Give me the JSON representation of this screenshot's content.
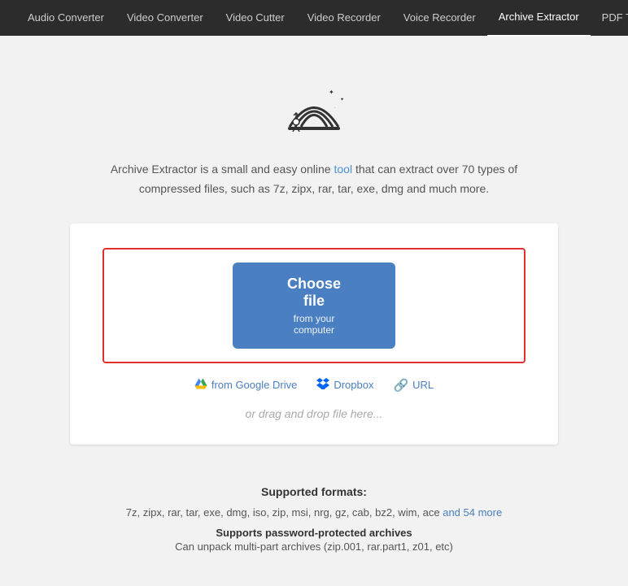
{
  "nav": {
    "items": [
      {
        "label": "Audio Converter",
        "active": false
      },
      {
        "label": "Video Converter",
        "active": false
      },
      {
        "label": "Video Cutter",
        "active": false
      },
      {
        "label": "Video Recorder",
        "active": false
      },
      {
        "label": "Voice Recorder",
        "active": false
      },
      {
        "label": "Archive Extractor",
        "active": true
      },
      {
        "label": "PDF Tools",
        "active": false
      }
    ]
  },
  "hero": {
    "description_1": "Archive Extractor is a small and easy online tool that can extract over 70 types of",
    "description_2": "compressed files, such as 7z, zipx, rar, tar, exe, dmg and much more.",
    "description_link": "tool"
  },
  "upload": {
    "choose_file_label": "Choose file",
    "choose_file_sub": "from your computer",
    "source_google": "from Google Drive",
    "source_dropbox": "Dropbox",
    "source_url": "URL",
    "drag_drop": "or drag and drop file here..."
  },
  "supported": {
    "title": "Supported formats:",
    "formats": "7z, zipx, rar, tar, exe, dmg, iso, zip, msi, nrg, gz, cab, bz2, wim, ace",
    "formats_link": "and 54 more",
    "feature_1": "Supports password-protected archives",
    "feature_2": "Can unpack multi-part archives (zip.001, rar.part1, z01, etc)"
  }
}
